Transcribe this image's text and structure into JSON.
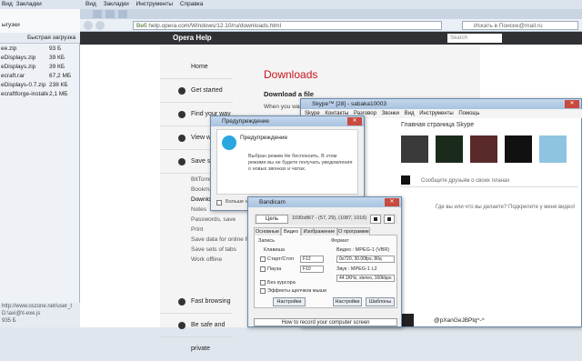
{
  "filepanel": {
    "menu": [
      "Вид",
      "Закладки",
      "Инструменты",
      "Справка"
    ],
    "tab_label": "ыгузки",
    "header": {
      "name": "",
      "size": "Быстрая загрузка"
    },
    "files": [
      {
        "name": "ee.zip",
        "size": "93 Б"
      },
      {
        "name": "eDisplays.zip",
        "size": "39 КБ"
      },
      {
        "name": "eDisplays.zip",
        "size": "39 КБ"
      },
      {
        "name": "ecraft.rar",
        "size": "67,2 МБ"
      },
      {
        "name": "eDisplays-0.7.zip",
        "size": "238 КБ"
      },
      {
        "name": "ecraftforge-installer-1...",
        "size": "2,1 МБ"
      }
    ],
    "status": [
      "http://www.oszone.net/user_t",
      "D:\\axi@\\t-exe.js",
      "935 Б",
      "93 Б"
    ]
  },
  "browser": {
    "menu": [
      "Вид",
      "Закладки",
      "Инструменты",
      "Справка"
    ],
    "address": {
      "secure": "Веб",
      "url": "help.opera.com/Windows/12.10/ru/downloads.html"
    },
    "search_placeholder": "Искать в Поиске@mail.ru",
    "header_title": "Opera Help",
    "header_search": "Search"
  },
  "help": {
    "nav": [
      {
        "label": "Home",
        "bullet": false
      },
      {
        "label": "Get started",
        "bullet": true
      },
      {
        "label": "Find your way",
        "bullet": true
      },
      {
        "label": "View web",
        "bullet": true
      },
      {
        "label": "Save stuff",
        "bullet": true
      }
    ],
    "sub": [
      "BitTorrent",
      "Bookmarks",
      "Downloads",
      "Notes",
      "Passwords, save",
      "Print",
      "Save data for online forms",
      "Save sets of tabs",
      "Work offline"
    ],
    "bottom": [
      "Fast browsing",
      "Be safe and private"
    ],
    "title": "Downloads",
    "subtitle": "Download a file",
    "body": "When you want"
  },
  "skype": {
    "title": "Skype™ [28] - sabaka10003",
    "menu": [
      "Skype",
      "Контакты",
      "Разговор",
      "Звонки",
      "Вид",
      "Инструменты",
      "Помощь"
    ],
    "home": "Главная страница Skype",
    "entry_placeholder": "Сообщите друзьям о своих планах",
    "entry2": "Где вы или что вы делаете? Подкрепите у меня видео!",
    "user": "@pXanGeJBPlq^-^"
  },
  "warning": {
    "title": "Предупреждение",
    "header": "Предупреждение",
    "message": "Выбран режим Не беспокоить. В этом режиме вы не будете получать уведомления о новых звонках и чатах.",
    "checkbox": "Больше не показывать",
    "ok": "OK"
  },
  "bandicam": {
    "title": "Bandicam",
    "mode": "Цель",
    "coords": "1030x867 - (57, 29), (1087, 1016)",
    "tabs": [
      "Основные",
      "Видео",
      "Изображение",
      "О программе"
    ],
    "active_tab": "Видео",
    "record_label": "Запись",
    "hotkey_label": "Клавиша",
    "start_stop": "Старт/Стоп",
    "start_stop_key": "F12",
    "pause": "Пауза",
    "pause_key": "F10",
    "cursor": "Без курсора",
    "mouse_effects": "Эффекты щелчков мыши",
    "settings1": "Настройки",
    "format_label": "Формат",
    "video_label": "Видео : MPEG-1 (VBR)",
    "video_val": "0x720, 30.00fps, 80q",
    "audio_label": "Звук : MPEG-1 L2",
    "audio_val": "44.1KHz, stereo, 160kbps",
    "settings2": "Настройки",
    "templates": "Шаблоны",
    "link": "How to record your computer screen"
  }
}
